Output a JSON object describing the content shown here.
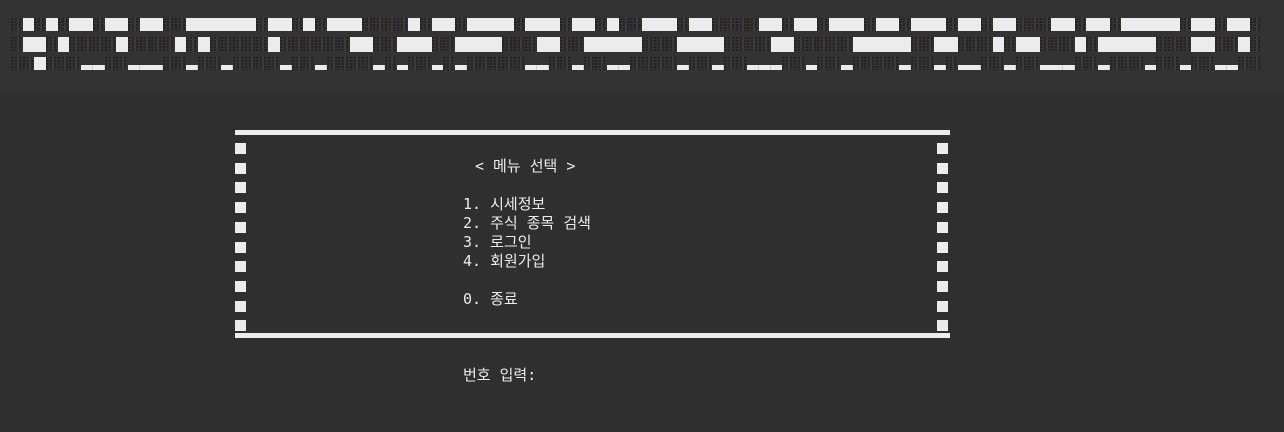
{
  "menu": {
    "title": "< 메뉴 선택 >",
    "items": [
      "1. 시세정보",
      "2. 주식 종목 검색",
      "3. 로그인",
      "4. 회원가입"
    ],
    "exit": "0. 종료"
  },
  "prompt": "번호 입력:"
}
